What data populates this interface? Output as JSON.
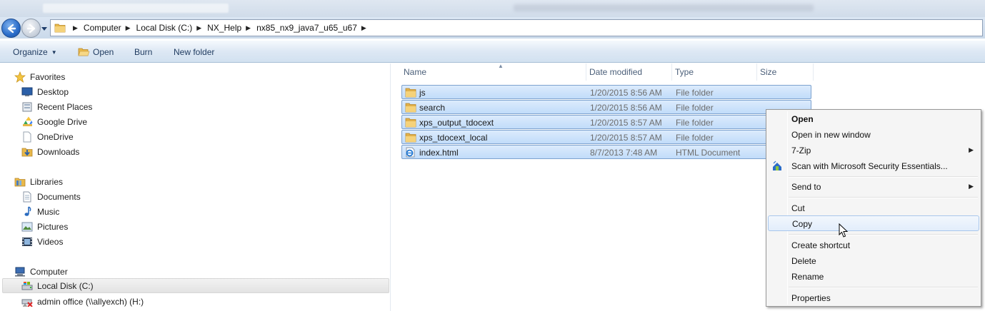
{
  "address_bar": {
    "breadcrumbs": [
      "Computer",
      "Local Disk (C:)",
      "NX_Help",
      "nx85_nx9_java7_u65_u67"
    ]
  },
  "command_bar": {
    "organize_label": "Organize",
    "open_label": "Open",
    "burn_label": "Burn",
    "new_folder_label": "New folder"
  },
  "nav_pane": {
    "favorites": {
      "header": "Favorites",
      "items": [
        "Desktop",
        "Recent Places",
        "Google Drive",
        "OneDrive",
        "Downloads"
      ]
    },
    "libraries": {
      "header": "Libraries",
      "items": [
        "Documents",
        "Music",
        "Pictures",
        "Videos"
      ]
    },
    "computer": {
      "header": "Computer",
      "items": [
        "Local Disk (C:)",
        "admin office (\\\\allyexch) (H:)"
      ],
      "selected_item": "Local Disk (C:)"
    }
  },
  "file_list": {
    "columns": [
      "Name",
      "Date modified",
      "Type",
      "Size"
    ],
    "rows": [
      {
        "name": "js",
        "date": "1/20/2015 8:56 AM",
        "type": "File folder",
        "icon": "folder-icon"
      },
      {
        "name": "search",
        "date": "1/20/2015 8:56 AM",
        "type": "File folder",
        "icon": "folder-icon"
      },
      {
        "name": "xps_output_tdocext",
        "date": "1/20/2015 8:57 AM",
        "type": "File folder",
        "icon": "folder-icon"
      },
      {
        "name": "xps_tdocext_local",
        "date": "1/20/2015 8:57 AM",
        "type": "File folder",
        "icon": "folder-icon"
      },
      {
        "name": "index.html",
        "date": "8/7/2013 7:48 AM",
        "type": "HTML Document",
        "icon": "html-file-icon"
      }
    ]
  },
  "context_menu": {
    "items": {
      "open": "Open",
      "open_new_window": "Open in new window",
      "seven_zip": "7-Zip",
      "scan": "Scan with Microsoft Security Essentials...",
      "send_to": "Send to",
      "cut": "Cut",
      "copy": "Copy",
      "create_shortcut": "Create shortcut",
      "delete": "Delete",
      "rename": "Rename",
      "properties": "Properties"
    },
    "highlighted_item": "Copy"
  },
  "colors": {
    "selection_fill": "#c8e0fb",
    "selection_border": "#7da2ce",
    "menu_highlight_border": "#a8c7ec",
    "command_text": "#1e3a5f",
    "header_text": "#4c607a"
  }
}
